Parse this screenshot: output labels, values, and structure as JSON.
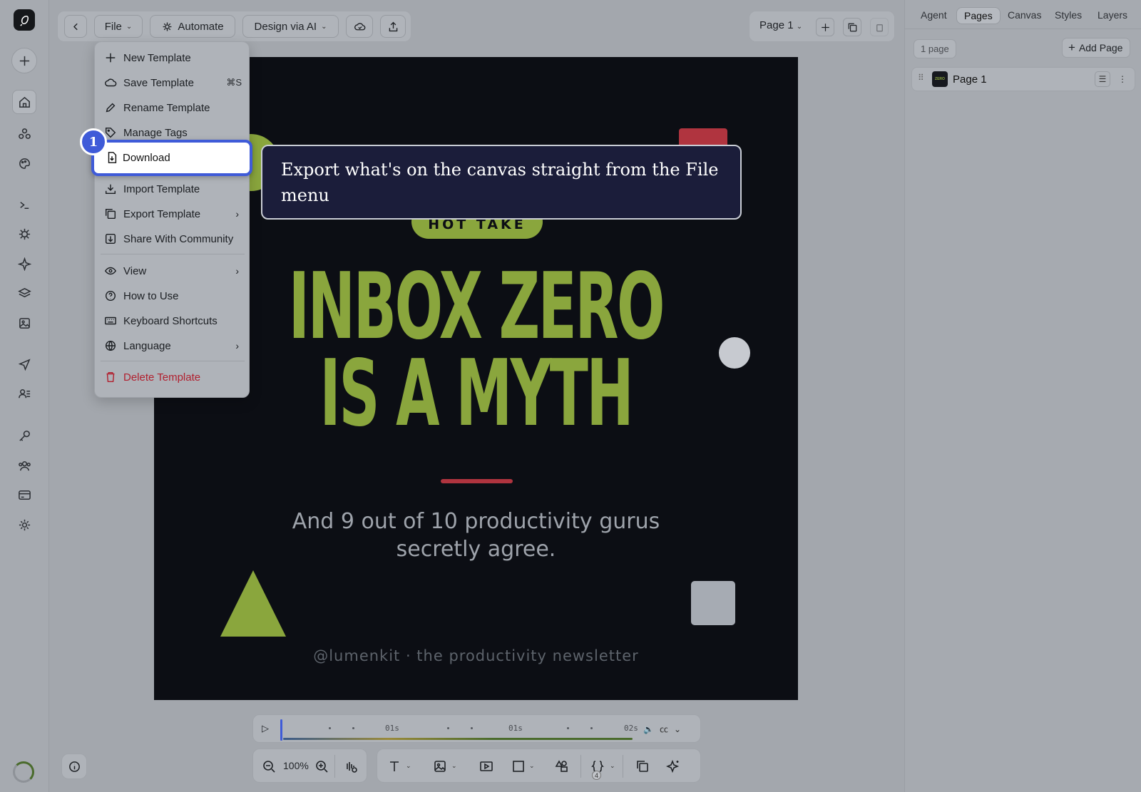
{
  "toolbar": {
    "file_label": "File",
    "automate_label": "Automate",
    "design_ai_label": "Design via AI"
  },
  "page_selector": {
    "label": "Page 1"
  },
  "right_panel": {
    "tabs": [
      {
        "label": "Agent"
      },
      {
        "label": "Pages",
        "active": true
      },
      {
        "label": "Canvas"
      },
      {
        "label": "Styles"
      },
      {
        "label": "Layers"
      }
    ],
    "page_count": "1 page",
    "add_page_label": "Add Page",
    "pages": [
      {
        "name": "Page 1",
        "thumb_text": "ZERO"
      }
    ]
  },
  "file_menu": {
    "items": [
      {
        "label": "New Template",
        "icon": "plus-icon"
      },
      {
        "label": "Save Template",
        "icon": "cloud-icon",
        "shortcut": "⌘S"
      },
      {
        "label": "Rename Template",
        "icon": "pencil-icon"
      },
      {
        "label": "Manage Tags",
        "icon": "tag-icon"
      },
      {
        "label": "Download",
        "icon": "download-file-icon",
        "highlighted": true
      },
      {
        "label": "Import Template",
        "icon": "import-icon"
      },
      {
        "label": "Export Template",
        "icon": "copy-icon",
        "submenu": true
      },
      {
        "label": "Share With Community",
        "icon": "share-community-icon"
      },
      {
        "label": "View",
        "icon": "eye-icon",
        "submenu": true
      },
      {
        "label": "How to Use",
        "icon": "help-icon"
      },
      {
        "label": "Keyboard Shortcuts",
        "icon": "keyboard-icon"
      },
      {
        "label": "Language",
        "icon": "globe-icon",
        "submenu": true
      },
      {
        "label": "Delete Template",
        "icon": "trash-icon",
        "danger": true
      }
    ]
  },
  "guide": {
    "step_number": "1",
    "tooltip_text": "Export what's on the canvas straight from the File menu"
  },
  "canvas": {
    "pill_text": "HOT TAKE",
    "headline_line1": "INBOX ZERO",
    "headline_line2": "IS A MYTH",
    "subline": "And 9 out of 10 productivity gurus secretly agree.",
    "handle": "@lumenkit · the productivity newsletter",
    "colors": {
      "background": "#0c0e14",
      "accent_green": "#8aa63d",
      "accent_red": "#b0343f"
    }
  },
  "timeline": {
    "labels": [
      "01s",
      "01s",
      "02s"
    ]
  },
  "bottom_bar": {
    "zoom": "100%",
    "variables_count": "4"
  }
}
